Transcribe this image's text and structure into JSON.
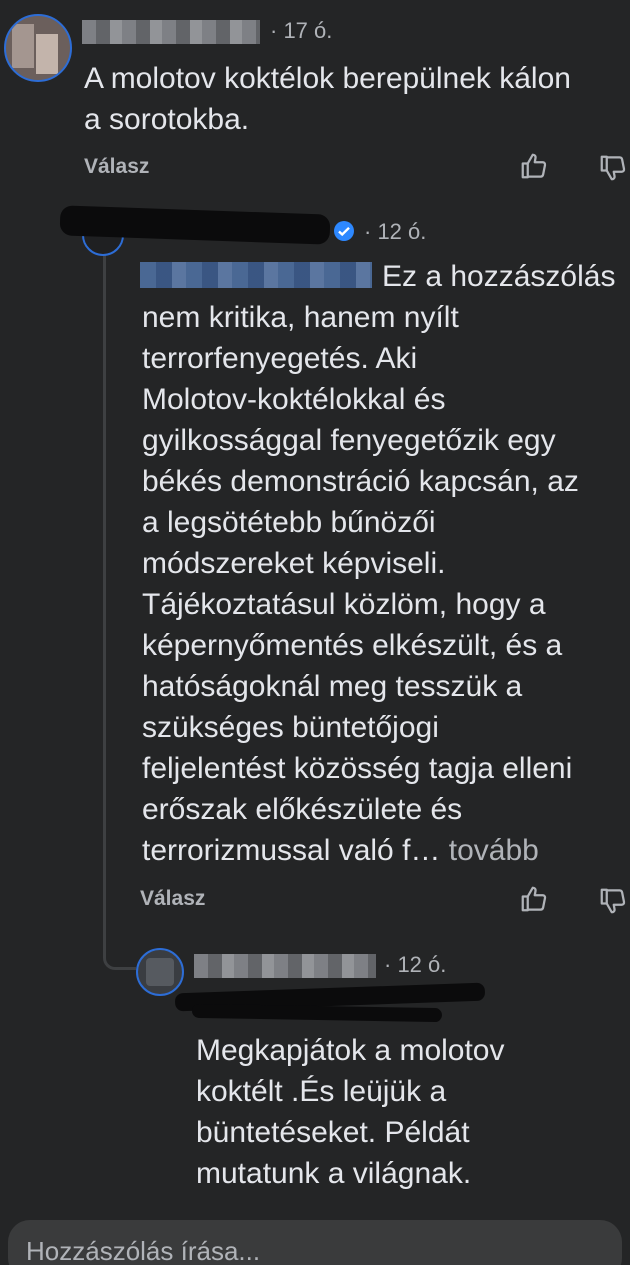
{
  "comment1": {
    "author": "",
    "time": "· 17 ó.",
    "lines": [
      "A molotov koktélok berepülnek kálon",
      "a sorotokba."
    ],
    "reply_label": "Válasz"
  },
  "comment2": {
    "author": "",
    "time": "· 12 ó.",
    "first_line": "Ez a hozzászólás",
    "lines": [
      "nem kritika, hanem nyílt",
      "terrorfenyegetés. Aki",
      "Molotov-koktélokkal és",
      "gyilkossággal fenyegetőzik egy",
      "békés demonstráció kapcsán, az",
      "a legsötétebb bűnözői",
      "módszereket képviseli.",
      "Tájékoztatásul közlöm, hogy a",
      "képernyőmentés elkészült, és a",
      "hatóságoknál meg tesszük a",
      "szükséges büntetőjogi",
      "feljelentést közösség tagja elleni",
      "erőszak előkészülete és"
    ],
    "last_line": "terrorizmussal való f… ",
    "more_label": "tovább",
    "reply_label": "Válasz"
  },
  "comment3": {
    "author": "",
    "time": "· 12 ó.",
    "lines": [
      "Megkapjátok a molotov",
      "koktélt .És leüjük a",
      "büntetéseket. Példát",
      "mutatunk a világnak."
    ]
  },
  "composer": {
    "placeholder": "Hozzászólás írása..."
  },
  "icons": {
    "like": "thumbs-up-icon",
    "dislike": "thumbs-down-icon",
    "verified": "verified-badge-icon"
  },
  "colors": {
    "background": "#242526",
    "text": "#e4e6eb",
    "muted": "#b0b3b8",
    "accent": "#2d88ff"
  }
}
